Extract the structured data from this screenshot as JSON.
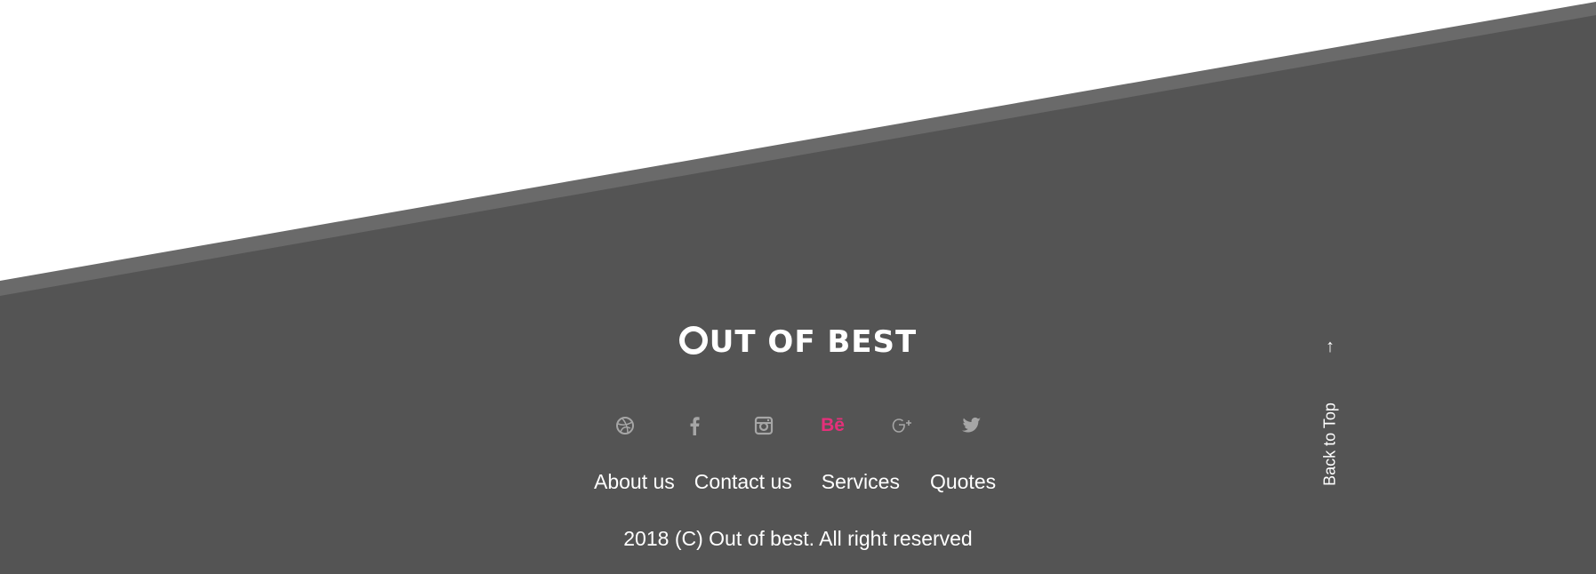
{
  "footer": {
    "logo": {
      "first_letter": "O",
      "rest": "UT OF BEST"
    },
    "social_icons": [
      {
        "name": "dribbble-icon",
        "glyph": "◎"
      },
      {
        "name": "facebook-icon",
        "glyph": "f"
      },
      {
        "name": "instagram-icon",
        "glyph": "◙"
      },
      {
        "name": "behance-icon",
        "glyph": "Bē"
      },
      {
        "name": "google-plus-icon",
        "glyph": "g+"
      },
      {
        "name": "twitter-icon",
        "glyph": "🐦"
      }
    ],
    "nav": [
      "About us",
      "Contact us",
      "Services",
      "Quotes"
    ],
    "copyright": "2018 (C) Out of best. All right reserved",
    "back_to_top": {
      "arrow": "↑",
      "label": "Back to Top"
    }
  },
  "colors": {
    "background": "#545454",
    "edge": "#6a6a6a",
    "accent": "#e5307a",
    "icon": "#a6a6a6"
  }
}
